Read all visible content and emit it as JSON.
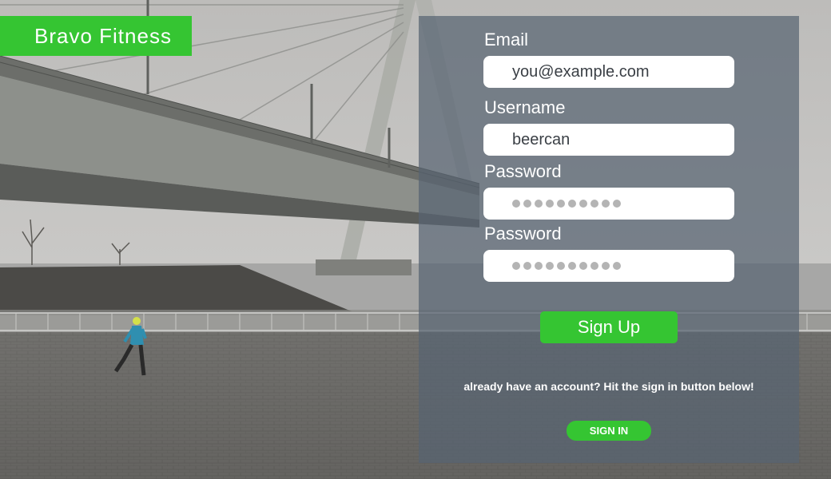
{
  "brand": {
    "name": "Bravo Fitness"
  },
  "form": {
    "email": {
      "label": "Email",
      "value": "you@example.com"
    },
    "username": {
      "label": "Username",
      "value": "beercan"
    },
    "password": {
      "label": "Password",
      "masked_length": 10
    },
    "password_confirm": {
      "label": "Password",
      "masked_length": 10
    },
    "signup_label": "Sign Up",
    "signin_prompt": "already have an account? Hit the sign in button below!",
    "signin_label": "SIGN IN"
  },
  "colors": {
    "accent": "#35c532",
    "panel": "#586472",
    "input_bg": "#ffffff",
    "masked_dot": "#b4b4b4"
  },
  "background": {
    "scene": "foggy-bridge-riverside-runner"
  }
}
